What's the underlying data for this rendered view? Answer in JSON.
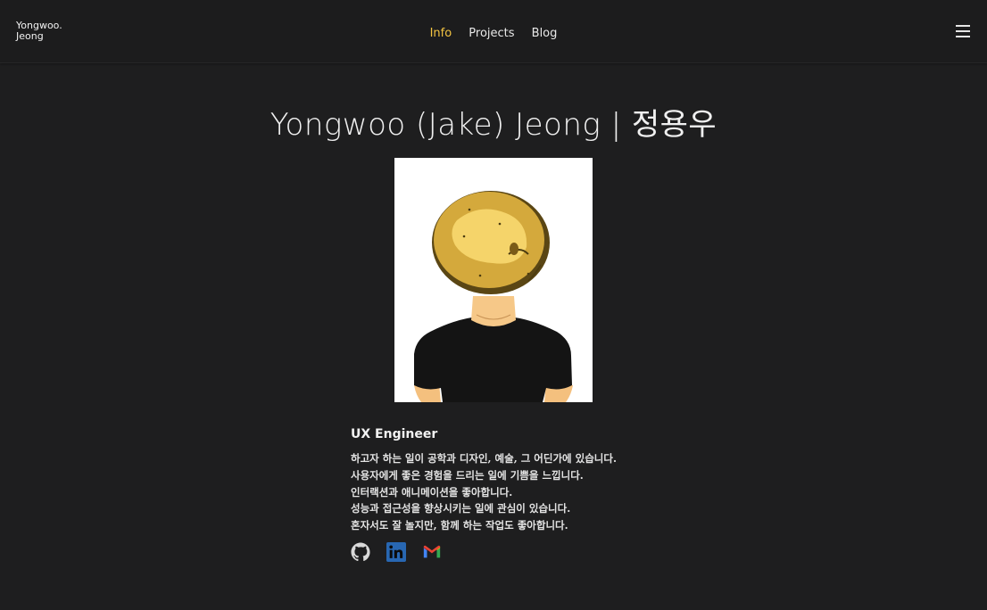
{
  "header": {
    "logo": "Yongwoo.\nJeong",
    "nav": [
      {
        "label": "Info",
        "active": true
      },
      {
        "label": "Projects",
        "active": false
      },
      {
        "label": "Blog",
        "active": false
      }
    ],
    "menu_icon": "hamburger-icon",
    "accent_color": "#f5c542"
  },
  "main": {
    "title": "Yongwoo (Jake) Jeong | 정용우",
    "role": "UX Engineer",
    "bio_lines": [
      "하고자 하는 일이 공학과 디자인, 예술, 그 어딘가에 있습니다.",
      "사용자에게 좋은 경험을 드리는 일에 기쁨을 느낍니다.",
      "인터랙션과 애니메이션을 좋아합니다.",
      "성능과 접근성을 향상시키는 일에 관심이 있습니다.",
      "혼자서도 잘 놀지만, 함께 하는 작업도 좋아합니다."
    ],
    "socials": [
      {
        "icon": "github-icon"
      },
      {
        "icon": "linkedin-icon",
        "color": "#2867b2"
      },
      {
        "icon": "gmail-icon"
      }
    ]
  }
}
